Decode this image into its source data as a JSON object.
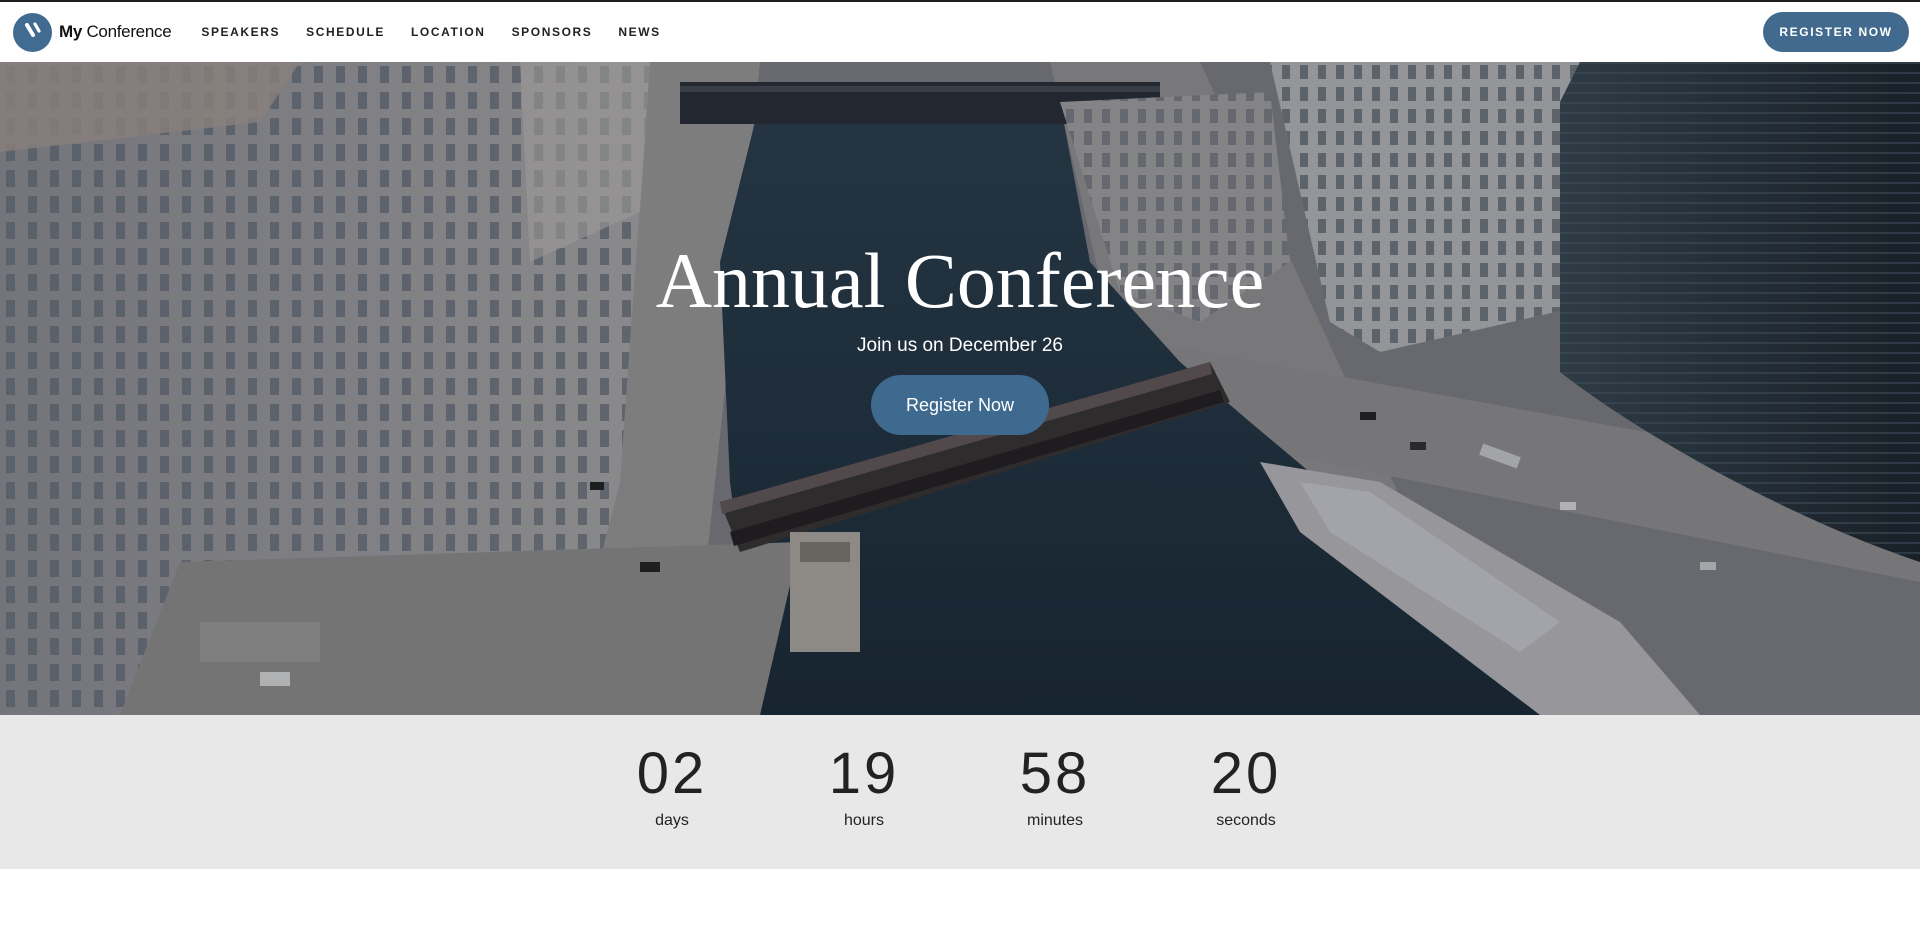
{
  "header": {
    "brand_bold": "My",
    "brand_rest": " Conference",
    "nav": [
      {
        "label": "SPEAKERS"
      },
      {
        "label": "SCHEDULE"
      },
      {
        "label": "LOCATION"
      },
      {
        "label": "SPONSORS"
      },
      {
        "label": "NEWS"
      }
    ],
    "cta_label": "REGISTER NOW"
  },
  "hero": {
    "title": "Annual Conference",
    "subtitle": "Join us on December 26",
    "cta_label": "Register Now"
  },
  "countdown": [
    {
      "value": "02",
      "label": "days"
    },
    {
      "value": "19",
      "label": "hours"
    },
    {
      "value": "58",
      "label": "minutes"
    },
    {
      "value": "20",
      "label": "seconds"
    }
  ],
  "colors": {
    "accent": "#426a8e",
    "countdown_bg": "#e8e8e8",
    "text_dark": "#222222"
  }
}
